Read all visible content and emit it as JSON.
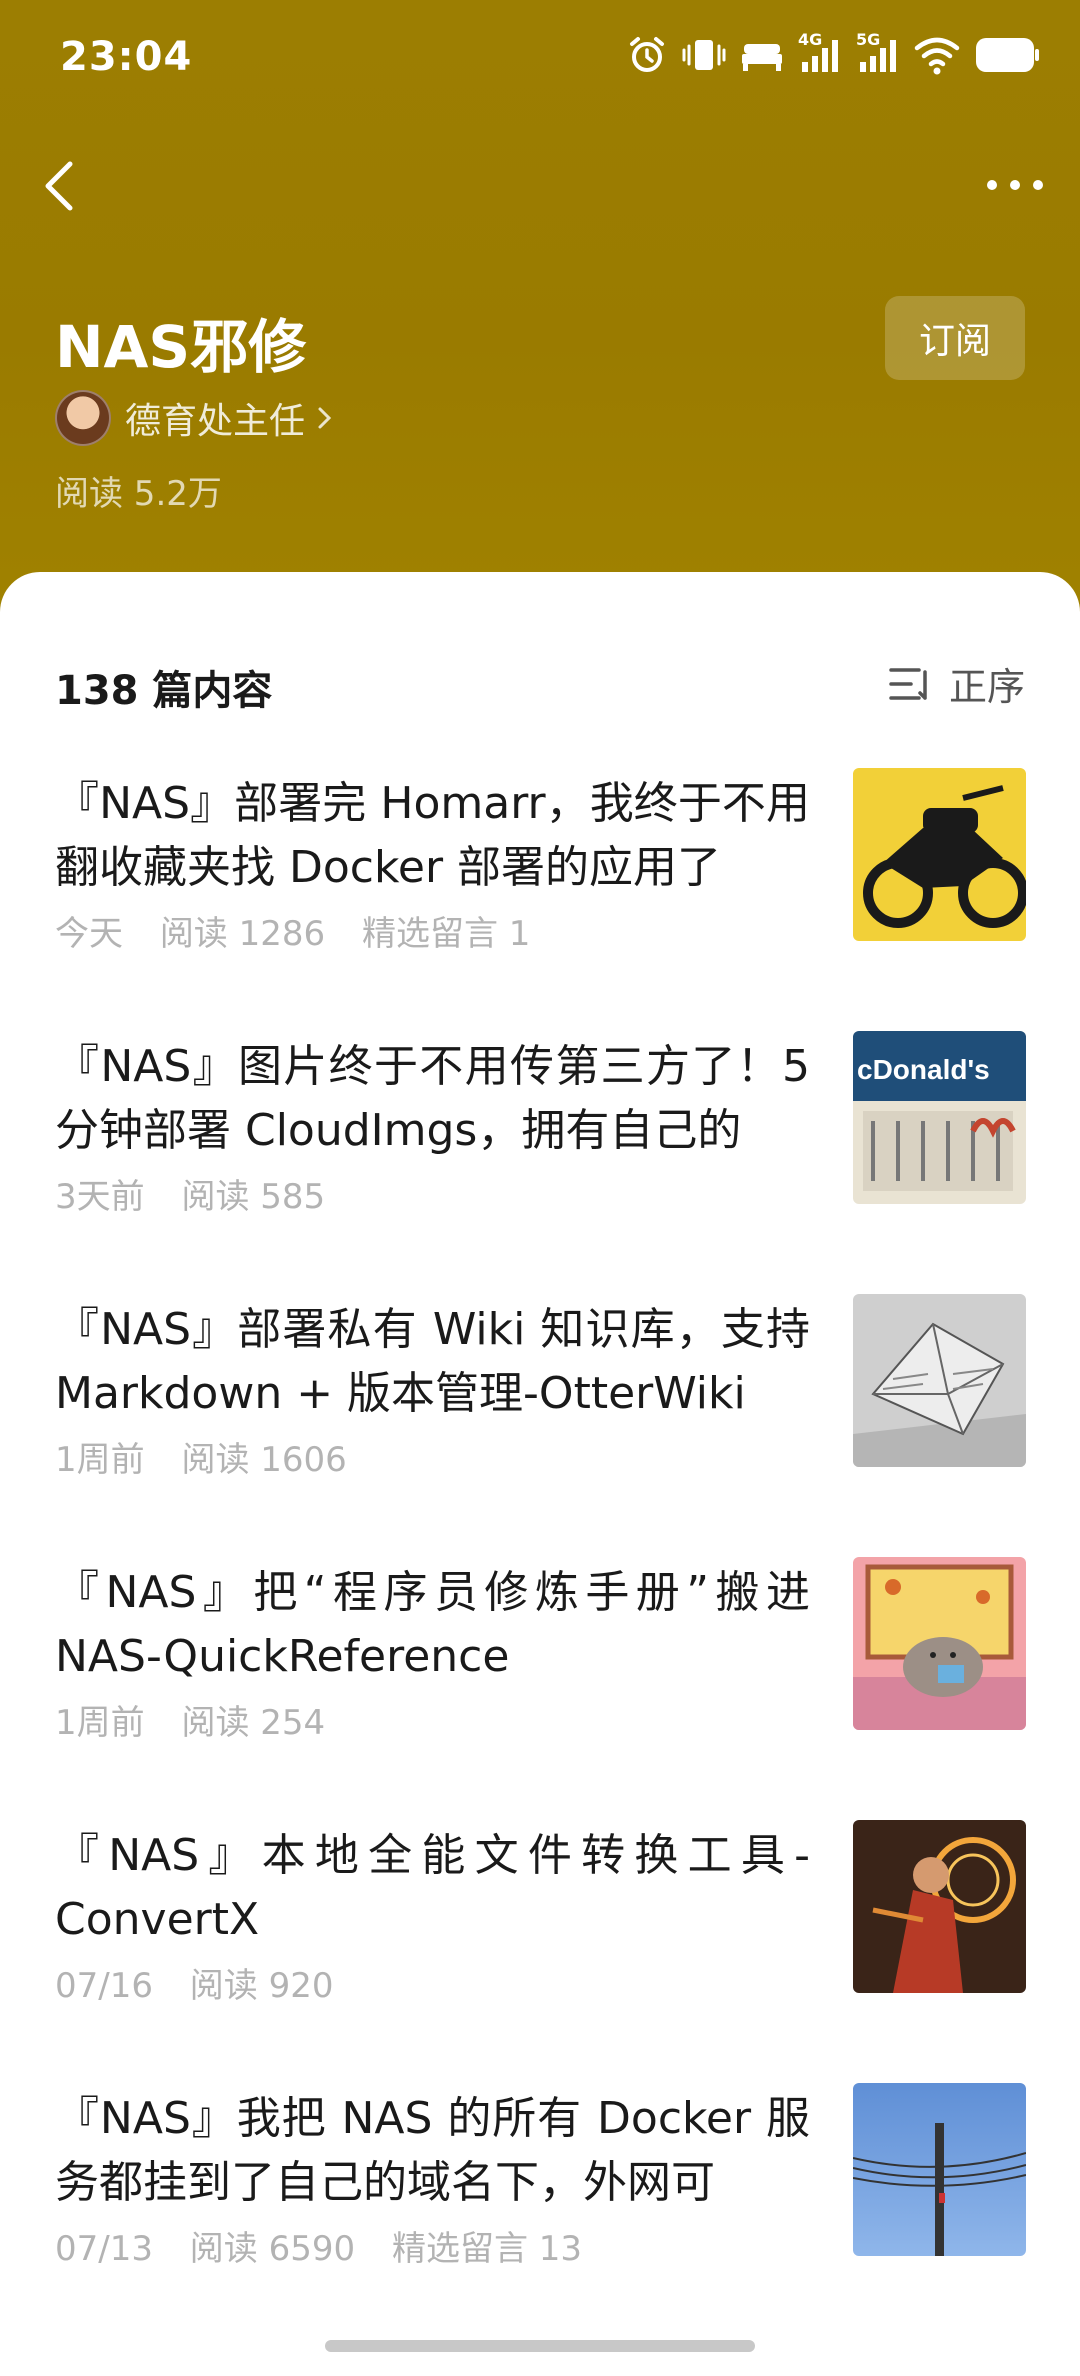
{
  "status": {
    "time": "23:04",
    "net1": "4G",
    "net2": "5G"
  },
  "header": {
    "title": "NAS邪修",
    "subscribe_label": "订阅",
    "author": "德育处主任",
    "reads": "阅读 5.2万"
  },
  "list_header": {
    "count": "138 篇内容",
    "sort_label": "正序"
  },
  "articles": [
    {
      "title": "『NAS』部署完 Homarr，我终于不用翻收藏夹找 Docker 部署的应用了",
      "date": "今天",
      "reads": "阅读 1286",
      "comments": "精选留言 1"
    },
    {
      "title": "『NAS』图片终于不用传第三方了！5 分钟部署 CloudImgs，拥有自己的",
      "date": "3天前",
      "reads": "阅读 585",
      "comments": ""
    },
    {
      "title": "『NAS』部署私有 Wiki 知识库，支持 Markdown + 版本管理-OtterWiki",
      "date": "1周前",
      "reads": "阅读 1606",
      "comments": ""
    },
    {
      "title": "『NAS』把“程序员修炼手册”搬进NAS-QuickReference",
      "date": "1周前",
      "reads": "阅读 254",
      "comments": ""
    },
    {
      "title": "『NAS』本地全能文件转换工具-ConvertX",
      "date": "07/16",
      "reads": "阅读 920",
      "comments": ""
    },
    {
      "title": "『NAS』我把 NAS 的所有 Docker 服务都挂到了自己的域名下，外网可",
      "date": "07/13",
      "reads": "阅读 6590",
      "comments": "精选留言 13"
    }
  ],
  "thumb_text": {
    "mcd": "cDonald's"
  },
  "colors": {
    "header_bg": "#9a7d00",
    "text_primary": "#1a1a1a",
    "text_meta": "#b3b3b3"
  }
}
